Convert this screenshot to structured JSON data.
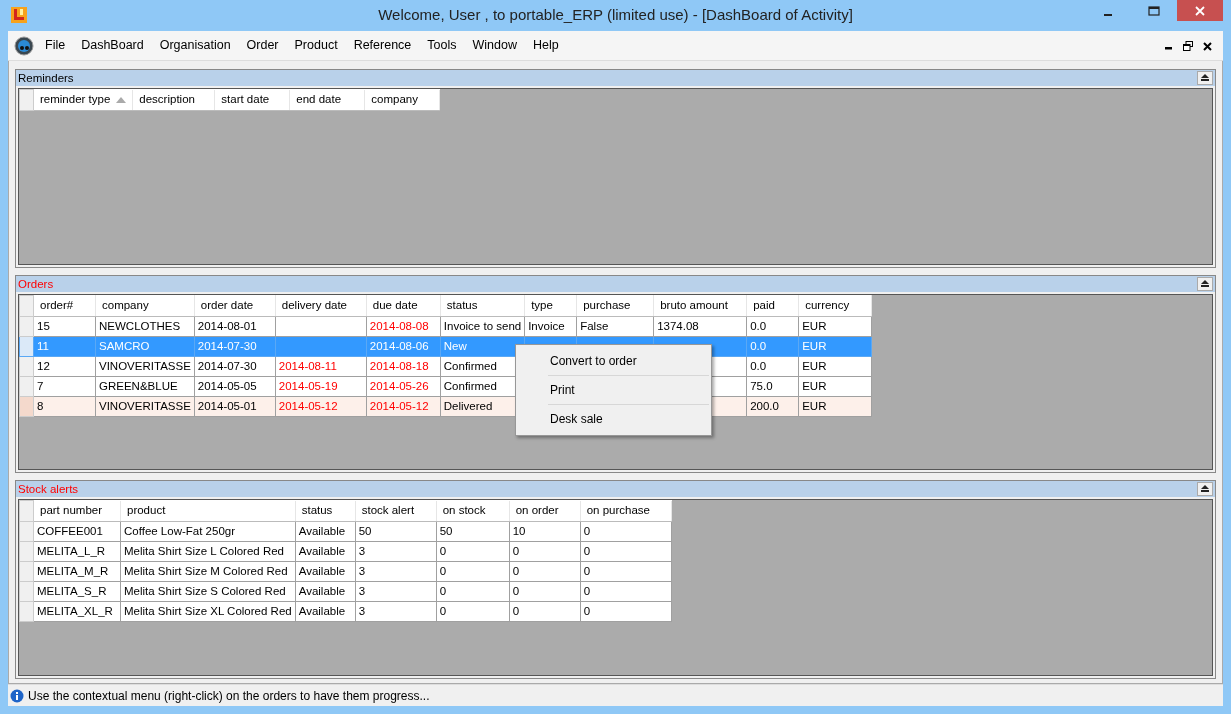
{
  "window": {
    "title": "Welcome, User , to portable_ERP (limited use) - [DashBoard of Activity]"
  },
  "menu": [
    "File",
    "DashBoard",
    "Organisation",
    "Order",
    "Product",
    "Reference",
    "Tools",
    "Window",
    "Help"
  ],
  "panels": [
    {
      "title": "Reminders",
      "alert": false,
      "columns": [
        {
          "label": "reminder type",
          "sorted": true
        },
        {
          "label": "description",
          "sorted": false
        },
        {
          "label": "start date",
          "sorted": false
        },
        {
          "label": "end date",
          "sorted": false
        },
        {
          "label": "company",
          "sorted": false
        }
      ]
    },
    {
      "title": "Orders",
      "alert": true,
      "columns": [
        {
          "label": "order#",
          "sorted": false
        },
        {
          "label": "company",
          "sorted": false
        },
        {
          "label": "order date",
          "sorted": false
        },
        {
          "label": "delivery date",
          "sorted": false
        },
        {
          "label": "due date",
          "sorted": false
        },
        {
          "label": "status",
          "sorted": false
        },
        {
          "label": "type",
          "sorted": false
        },
        {
          "label": "purchase",
          "sorted": false
        },
        {
          "label": "bruto amount",
          "sorted": false
        },
        {
          "label": "paid",
          "sorted": false
        },
        {
          "label": "currency",
          "sorted": false
        }
      ],
      "rows": [
        {
          "selected": false,
          "highlighted": false,
          "cells": [
            {
              "text": "15"
            },
            {
              "text": "NEWCLOTHES"
            },
            {
              "text": "2014-08-01"
            },
            null,
            {
              "text": "2014-08-08",
              "late": true
            },
            {
              "text": "Invoice to send"
            },
            {
              "text": "Invoice"
            },
            {
              "text": "False"
            },
            {
              "text": "1374.08"
            },
            {
              "text": "0.0"
            },
            {
              "text": "EUR"
            }
          ]
        },
        {
          "selected": true,
          "highlighted": false,
          "cells": [
            {
              "text": "11"
            },
            {
              "text": "SAMCRO"
            },
            {
              "text": "2014-07-30"
            },
            null,
            {
              "text": "2014-08-06",
              "late": false
            },
            {
              "text": "New"
            },
            null,
            null,
            null,
            {
              "text": "0.0"
            },
            {
              "text": "EUR"
            }
          ]
        },
        {
          "selected": false,
          "highlighted": false,
          "cells": [
            {
              "text": "12"
            },
            {
              "text": "VINOVERITASSE"
            },
            {
              "text": "2014-07-30"
            },
            {
              "text": "2014-08-11",
              "late": true
            },
            {
              "text": "2014-08-18",
              "late": true
            },
            {
              "text": "Confirmed"
            },
            null,
            null,
            null,
            {
              "text": "0.0"
            },
            {
              "text": "EUR"
            }
          ]
        },
        {
          "selected": false,
          "highlighted": false,
          "cells": [
            {
              "text": "7"
            },
            {
              "text": "GREEN&BLUE"
            },
            {
              "text": "2014-05-05"
            },
            {
              "text": "2014-05-19",
              "late": true
            },
            {
              "text": "2014-05-26",
              "late": true
            },
            {
              "text": "Confirmed"
            },
            null,
            null,
            null,
            {
              "text": "75.0"
            },
            {
              "text": "EUR"
            }
          ]
        },
        {
          "selected": false,
          "highlighted": true,
          "cells": [
            {
              "text": "8"
            },
            {
              "text": "VINOVERITASSE"
            },
            {
              "text": "2014-05-01"
            },
            {
              "text": "2014-05-12",
              "late": true
            },
            {
              "text": "2014-05-12",
              "late": true
            },
            {
              "text": "Delivered"
            },
            null,
            null,
            null,
            {
              "text": "200.0"
            },
            {
              "text": "EUR"
            }
          ]
        }
      ]
    },
    {
      "title": "Stock alerts",
      "alert": true,
      "columns": [
        {
          "label": "part number",
          "sorted": false
        },
        {
          "label": "product",
          "sorted": false
        },
        {
          "label": "status",
          "sorted": false
        },
        {
          "label": "stock alert",
          "sorted": false
        },
        {
          "label": "on stock",
          "sorted": false
        },
        {
          "label": "on order",
          "sorted": false
        },
        {
          "label": "on purchase",
          "sorted": false
        }
      ],
      "rows": [
        {
          "selected": false,
          "highlighted": false,
          "cells": [
            {
              "text": "COFFEE001"
            },
            {
              "text": "Coffee Low-Fat 250gr"
            },
            {
              "text": "Available"
            },
            {
              "text": "50"
            },
            {
              "text": "50"
            },
            {
              "text": "10"
            },
            {
              "text": "0"
            }
          ]
        },
        {
          "selected": false,
          "highlighted": false,
          "cells": [
            {
              "text": "MELITA_L_R"
            },
            {
              "text": "Melita Shirt Size L Colored Red"
            },
            {
              "text": "Available"
            },
            {
              "text": "3"
            },
            {
              "text": "0"
            },
            {
              "text": "0"
            },
            {
              "text": "0"
            }
          ]
        },
        {
          "selected": false,
          "highlighted": false,
          "cells": [
            {
              "text": "MELITA_M_R"
            },
            {
              "text": "Melita Shirt Size M Colored Red"
            },
            {
              "text": "Available"
            },
            {
              "text": "3"
            },
            {
              "text": "0"
            },
            {
              "text": "0"
            },
            {
              "text": "0"
            }
          ]
        },
        {
          "selected": false,
          "highlighted": false,
          "cells": [
            {
              "text": "MELITA_S_R"
            },
            {
              "text": "Melita Shirt Size S Colored Red"
            },
            {
              "text": "Available"
            },
            {
              "text": "3"
            },
            {
              "text": "0"
            },
            {
              "text": "0"
            },
            {
              "text": "0"
            }
          ]
        },
        {
          "selected": false,
          "highlighted": false,
          "cells": [
            {
              "text": "MELITA_XL_R"
            },
            {
              "text": "Melita Shirt Size XL Colored Red"
            },
            {
              "text": "Available"
            },
            {
              "text": "3"
            },
            {
              "text": "0"
            },
            {
              "text": "0"
            },
            {
              "text": "0"
            }
          ]
        }
      ]
    }
  ],
  "context_menu": [
    "Convert to order",
    "Print",
    "Desk sale"
  ],
  "status_bar": "Use the contextual menu (right-click) on the orders to have them progress..."
}
